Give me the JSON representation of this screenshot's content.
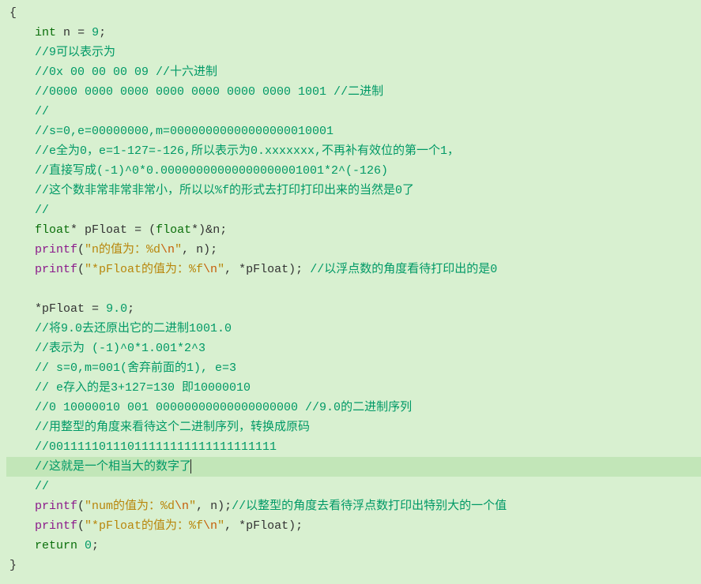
{
  "code_lines": [
    {
      "idx": 0,
      "hl": false,
      "tokens": [
        {
          "t": "kw",
          "v": "int"
        },
        {
          "t": "sp",
          "v": " "
        },
        {
          "t": "ident",
          "v": "n"
        },
        {
          "t": "sp",
          "v": " "
        },
        {
          "t": "op",
          "v": "="
        },
        {
          "t": "sp",
          "v": " "
        },
        {
          "t": "num",
          "v": "9"
        },
        {
          "t": "punct",
          "v": ";"
        }
      ]
    },
    {
      "idx": 1,
      "hl": false,
      "tokens": [
        {
          "t": "comment",
          "v": "//9可以表示为"
        }
      ]
    },
    {
      "idx": 2,
      "hl": false,
      "tokens": [
        {
          "t": "comment",
          "v": "//0x 00 00 00 09 //十六进制"
        }
      ]
    },
    {
      "idx": 3,
      "hl": false,
      "tokens": [
        {
          "t": "comment",
          "v": "//0000 0000 0000 0000 0000 0000 0000 1001 //二进制"
        }
      ]
    },
    {
      "idx": 4,
      "hl": false,
      "tokens": [
        {
          "t": "comment",
          "v": "//"
        }
      ]
    },
    {
      "idx": 5,
      "hl": false,
      "tokens": [
        {
          "t": "comment",
          "v": "//s=0,e=00000000,m=00000000000000000010001"
        }
      ]
    },
    {
      "idx": 6,
      "hl": false,
      "tokens": [
        {
          "t": "comment",
          "v": "//e全为0，e=1-127=-126,所以表示为0.xxxxxxx,不再补有效位的第一个1，"
        }
      ]
    },
    {
      "idx": 7,
      "hl": false,
      "tokens": [
        {
          "t": "comment",
          "v": "//直接写成(-1)^0*0.00000000000000000001001*2^(-126)"
        }
      ]
    },
    {
      "idx": 8,
      "hl": false,
      "tokens": [
        {
          "t": "comment",
          "v": "//这个数非常非常非常小，所以以%f的形式去打印打印出来的当然是0了"
        }
      ]
    },
    {
      "idx": 9,
      "hl": false,
      "tokens": [
        {
          "t": "comment",
          "v": "//"
        }
      ]
    },
    {
      "idx": 10,
      "hl": false,
      "tokens": [
        {
          "t": "kw",
          "v": "float"
        },
        {
          "t": "op",
          "v": "*"
        },
        {
          "t": "sp",
          "v": " "
        },
        {
          "t": "ident",
          "v": "pFloat"
        },
        {
          "t": "sp",
          "v": " "
        },
        {
          "t": "op",
          "v": "="
        },
        {
          "t": "sp",
          "v": " "
        },
        {
          "t": "punct",
          "v": "("
        },
        {
          "t": "kw",
          "v": "float"
        },
        {
          "t": "op",
          "v": "*"
        },
        {
          "t": "punct",
          "v": ")"
        },
        {
          "t": "op",
          "v": "&"
        },
        {
          "t": "ident",
          "v": "n"
        },
        {
          "t": "punct",
          "v": ";"
        }
      ]
    },
    {
      "idx": 11,
      "hl": false,
      "tokens": [
        {
          "t": "func",
          "v": "printf"
        },
        {
          "t": "punct",
          "v": "("
        },
        {
          "t": "str",
          "v": "\"n的值为：%d"
        },
        {
          "t": "esc",
          "v": "\\n"
        },
        {
          "t": "str",
          "v": "\""
        },
        {
          "t": "punct",
          "v": ","
        },
        {
          "t": "sp",
          "v": " "
        },
        {
          "t": "ident",
          "v": "n"
        },
        {
          "t": "punct",
          "v": ")"
        },
        {
          "t": "punct",
          "v": ";"
        }
      ]
    },
    {
      "idx": 12,
      "hl": false,
      "tokens": [
        {
          "t": "func",
          "v": "printf"
        },
        {
          "t": "punct",
          "v": "("
        },
        {
          "t": "str",
          "v": "\"*pFloat的值为：%f"
        },
        {
          "t": "esc",
          "v": "\\n"
        },
        {
          "t": "str",
          "v": "\""
        },
        {
          "t": "punct",
          "v": ","
        },
        {
          "t": "sp",
          "v": " "
        },
        {
          "t": "op",
          "v": "*"
        },
        {
          "t": "ident",
          "v": "pFloat"
        },
        {
          "t": "punct",
          "v": ")"
        },
        {
          "t": "punct",
          "v": ";"
        },
        {
          "t": "sp",
          "v": " "
        },
        {
          "t": "comment",
          "v": "//以浮点数的角度看待打印出的是0"
        }
      ]
    },
    {
      "idx": 13,
      "hl": false,
      "tokens": []
    },
    {
      "idx": 14,
      "hl": false,
      "tokens": [
        {
          "t": "op",
          "v": "*"
        },
        {
          "t": "ident",
          "v": "pFloat"
        },
        {
          "t": "sp",
          "v": " "
        },
        {
          "t": "op",
          "v": "="
        },
        {
          "t": "sp",
          "v": " "
        },
        {
          "t": "num",
          "v": "9.0"
        },
        {
          "t": "punct",
          "v": ";"
        }
      ]
    },
    {
      "idx": 15,
      "hl": false,
      "tokens": [
        {
          "t": "comment",
          "v": "//将9.0去还原出它的二进制1001.0"
        }
      ]
    },
    {
      "idx": 16,
      "hl": false,
      "tokens": [
        {
          "t": "comment",
          "v": "//表示为 (-1)^0*1.001*2^3"
        }
      ]
    },
    {
      "idx": 17,
      "hl": false,
      "tokens": [
        {
          "t": "comment",
          "v": "// s=0,m=001(舍弃前面的1), e=3"
        }
      ]
    },
    {
      "idx": 18,
      "hl": false,
      "tokens": [
        {
          "t": "comment",
          "v": "// e存入的是3+127=130 即10000010"
        }
      ]
    },
    {
      "idx": 19,
      "hl": false,
      "tokens": [
        {
          "t": "comment",
          "v": "//0 10000010 001 00000000000000000000 //9.0的二进制序列"
        }
      ]
    },
    {
      "idx": 20,
      "hl": false,
      "tokens": [
        {
          "t": "comment",
          "v": "//用整型的角度来看待这个二进制序列，转换成原码"
        }
      ]
    },
    {
      "idx": 21,
      "hl": false,
      "tokens": [
        {
          "t": "comment",
          "v": "//00111110111011111111111111111111"
        }
      ]
    },
    {
      "idx": 22,
      "hl": true,
      "tokens": [
        {
          "t": "comment",
          "v": "//这就是一个相当大的数字了"
        },
        {
          "t": "cursor",
          "v": ""
        }
      ]
    },
    {
      "idx": 23,
      "hl": false,
      "tokens": [
        {
          "t": "comment",
          "v": "//"
        }
      ]
    },
    {
      "idx": 24,
      "hl": false,
      "tokens": [
        {
          "t": "func",
          "v": "printf"
        },
        {
          "t": "punct",
          "v": "("
        },
        {
          "t": "str",
          "v": "\"num的值为：%d"
        },
        {
          "t": "esc",
          "v": "\\n"
        },
        {
          "t": "str",
          "v": "\""
        },
        {
          "t": "punct",
          "v": ","
        },
        {
          "t": "sp",
          "v": " "
        },
        {
          "t": "ident",
          "v": "n"
        },
        {
          "t": "punct",
          "v": ")"
        },
        {
          "t": "punct",
          "v": ";"
        },
        {
          "t": "comment",
          "v": "//以整型的角度去看待浮点数打印出特别大的一个值"
        }
      ]
    },
    {
      "idx": 25,
      "hl": false,
      "tokens": [
        {
          "t": "func",
          "v": "printf"
        },
        {
          "t": "punct",
          "v": "("
        },
        {
          "t": "str",
          "v": "\"*pFloat的值为：%f"
        },
        {
          "t": "esc",
          "v": "\\n"
        },
        {
          "t": "str",
          "v": "\""
        },
        {
          "t": "punct",
          "v": ","
        },
        {
          "t": "sp",
          "v": " "
        },
        {
          "t": "op",
          "v": "*"
        },
        {
          "t": "ident",
          "v": "pFloat"
        },
        {
          "t": "punct",
          "v": ")"
        },
        {
          "t": "punct",
          "v": ";"
        }
      ]
    },
    {
      "idx": 26,
      "hl": false,
      "tokens": [
        {
          "t": "kw",
          "v": "return"
        },
        {
          "t": "sp",
          "v": " "
        },
        {
          "t": "num",
          "v": "0"
        },
        {
          "t": "punct",
          "v": ";"
        }
      ]
    }
  ],
  "closing_brace": "}"
}
